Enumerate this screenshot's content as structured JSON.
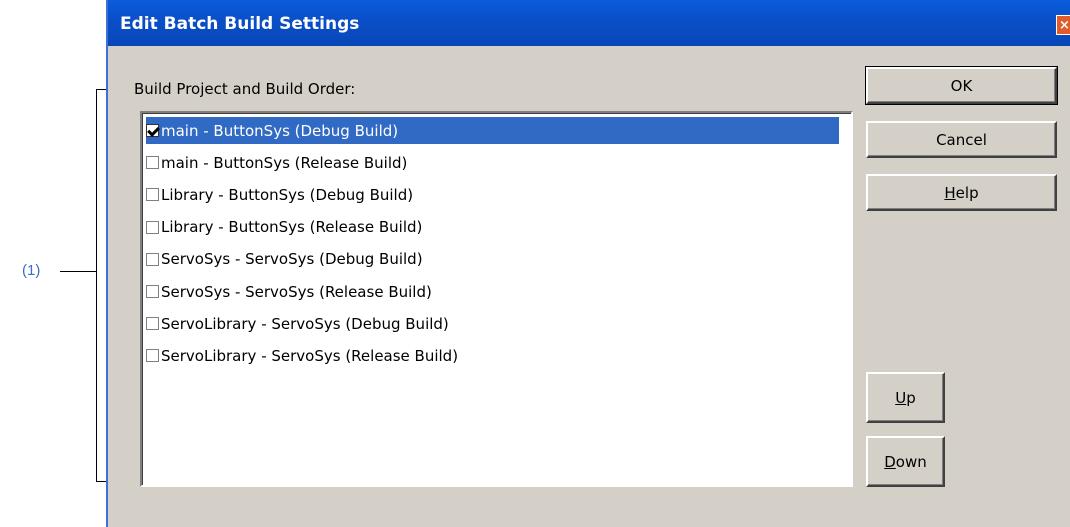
{
  "annotation": {
    "label": "(1)"
  },
  "dialog": {
    "title": "Edit Batch Build Settings",
    "close_glyph": "×",
    "group_label": "Build Project and Build Order:",
    "items": [
      {
        "label": "main - ButtonSys (Debug Build)",
        "checked": true,
        "selected": true
      },
      {
        "label": "main - ButtonSys (Release Build)",
        "checked": false,
        "selected": false
      },
      {
        "label": "Library - ButtonSys (Debug Build)",
        "checked": false,
        "selected": false
      },
      {
        "label": "Library - ButtonSys (Release Build)",
        "checked": false,
        "selected": false
      },
      {
        "label": "ServoSys - ServoSys (Debug Build)",
        "checked": false,
        "selected": false
      },
      {
        "label": "ServoSys - ServoSys (Release Build)",
        "checked": false,
        "selected": false
      },
      {
        "label": "ServoLibrary - ServoSys (Debug Build)",
        "checked": false,
        "selected": false
      },
      {
        "label": "ServoLibrary - ServoSys (Release Build)",
        "checked": false,
        "selected": false
      }
    ],
    "buttons": {
      "ok": "OK",
      "cancel": "Cancel",
      "help_pre": "",
      "help_key": "H",
      "help_post": "elp",
      "up_pre": "",
      "up_key": "U",
      "up_post": "p",
      "down_pre": "",
      "down_key": "D",
      "down_post": "own"
    }
  }
}
